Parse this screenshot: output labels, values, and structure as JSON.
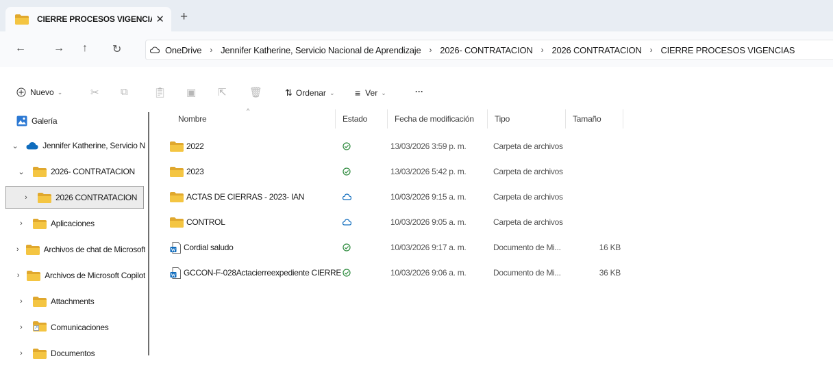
{
  "tab": {
    "title": "CIERRE PROCESOS VIGENCIAS",
    "close": "✕",
    "new": "+"
  },
  "nav": {
    "back": "←",
    "forward": "→",
    "up": "↑",
    "refresh": "↻"
  },
  "breadcrumb": [
    "OneDrive",
    "Jennifer Katherine, Servicio Nacional de Aprendizaje",
    "2026- CONTRATACION",
    "2026 CONTRATACION",
    "CIERRE PROCESOS VIGENCIAS"
  ],
  "breadcrumb_sep": "›",
  "toolbar": {
    "new_label": "Nuevo",
    "sort_label": "Ordenar",
    "view_label": "Ver",
    "more": "···"
  },
  "sidebar": [
    {
      "label": "Galería",
      "chev": ""
    },
    {
      "label": "Jennifer Katherine, Servicio N",
      "chev": "⌄"
    },
    {
      "label": "2026- CONTRATACION",
      "chev": "⌄"
    },
    {
      "label": "2026 CONTRATACION",
      "chev": "›"
    },
    {
      "label": "Aplicaciones",
      "chev": "›"
    },
    {
      "label": "Archivos de chat de Microsoft",
      "chev": "›"
    },
    {
      "label": "Archivos de Microsoft Copilot",
      "chev": "›"
    },
    {
      "label": "Attachments",
      "chev": "›"
    },
    {
      "label": "Comunicaciones",
      "chev": "›"
    },
    {
      "label": "Documentos",
      "chev": "›"
    }
  ],
  "columns": {
    "name": "Nombre",
    "status": "Estado",
    "date": "Fecha de modificación",
    "type": "Tipo",
    "size": "Tamaño"
  },
  "files": [
    {
      "name": "2022",
      "status": "ok",
      "date": "13/03/2026 3:59 p. m.",
      "type": "Carpeta de archivos",
      "size": "",
      "kind": "folder"
    },
    {
      "name": "2023",
      "status": "ok",
      "date": "13/03/2026 5:42 p. m.",
      "type": "Carpeta de archivos",
      "size": "",
      "kind": "folder"
    },
    {
      "name": "ACTAS DE CIERRAS - 2023- IAN",
      "status": "cloud",
      "date": "10/03/2026 9:15 a. m.",
      "type": "Carpeta de archivos",
      "size": "",
      "kind": "folder"
    },
    {
      "name": "CONTROL",
      "status": "cloud",
      "date": "10/03/2026 9:05 a. m.",
      "type": "Carpeta de archivos",
      "size": "",
      "kind": "folder"
    },
    {
      "name": "Cordial saludo",
      "status": "ok",
      "date": "10/03/2026 9:17 a. m.",
      "type": "Documento de Mi...",
      "size": "16 KB",
      "kind": "doc"
    },
    {
      "name": "GCCON-F-028Actacierreexpediente CIERRE",
      "status": "ok",
      "date": "10/03/2026 9:06 a. m.",
      "type": "Documento de Mi...",
      "size": "36 KB",
      "kind": "doc"
    }
  ],
  "colors": {
    "folder": "#f4c542",
    "folder_dark": "#e0a82e",
    "accent": "#0f6cbd",
    "ok": "#2e8b3e"
  }
}
